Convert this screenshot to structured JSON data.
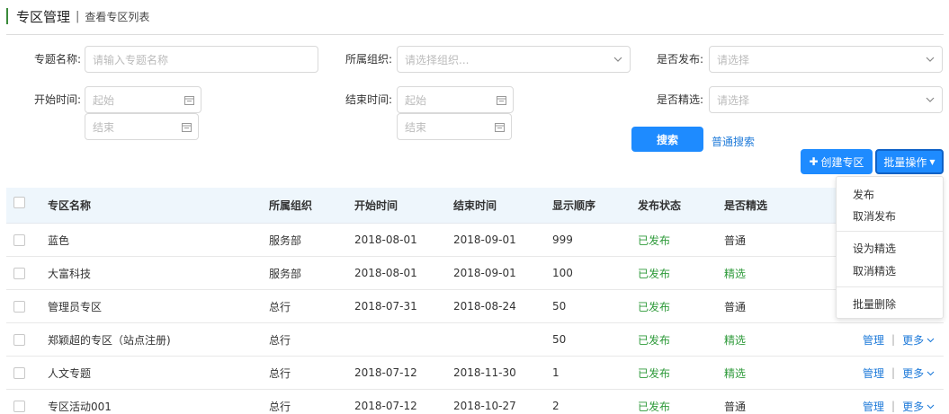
{
  "header": {
    "title": "专区管理",
    "separator": "|",
    "subtitle": "查看专区列表"
  },
  "filters": {
    "topic_name": {
      "label": "专题名称:",
      "placeholder": "请输入专题名称"
    },
    "org": {
      "label": "所属组织:",
      "placeholder": "请选择组织..."
    },
    "published": {
      "label": "是否发布:",
      "placeholder": "请选择"
    },
    "start_time": {
      "label": "开始时间:",
      "from_placeholder": "起始",
      "to_placeholder": "结束"
    },
    "end_time": {
      "label": "结束时间:",
      "from_placeholder": "起始",
      "to_placeholder": "结束"
    },
    "featured": {
      "label": "是否精选:",
      "placeholder": "请选择"
    },
    "search_button": "搜索",
    "normal_search_link": "普通搜索"
  },
  "toolbar": {
    "create_button": "创建专区",
    "batch_button": "批量操作"
  },
  "table": {
    "columns": [
      "专区名称",
      "所属组织",
      "开始时间",
      "结束时间",
      "显示顺序",
      "发布状态",
      "是否精选"
    ],
    "rows": [
      {
        "name": "蓝色",
        "org": "服务部",
        "start": "2018-08-01",
        "end": "2018-09-01",
        "order": "999",
        "status": "已发布",
        "featured": "普通"
      },
      {
        "name": "大富科技",
        "org": "服务部",
        "start": "2018-08-01",
        "end": "2018-09-01",
        "order": "100",
        "status": "已发布",
        "featured": "精选"
      },
      {
        "name": "管理员专区",
        "org": "总行",
        "start": "2018-07-31",
        "end": "2018-08-24",
        "order": "50",
        "status": "已发布",
        "featured": "普通"
      },
      {
        "name": "郑颖超的专区（站点注册)",
        "org": "总行",
        "start": "",
        "end": "",
        "order": "50",
        "status": "已发布",
        "featured": "精选",
        "manage": "管理",
        "more": "更多"
      },
      {
        "name": "人文专题",
        "org": "总行",
        "start": "2018-07-12",
        "end": "2018-11-30",
        "order": "1",
        "status": "已发布",
        "featured": "精选",
        "manage": "管理",
        "more": "更多"
      },
      {
        "name": "专区活动001",
        "org": "总行",
        "start": "2018-07-12",
        "end": "2018-10-27",
        "order": "2",
        "status": "已发布",
        "featured": "普通",
        "manage": "管理",
        "more": "更多"
      }
    ]
  },
  "batch_menu": {
    "items": [
      "发布",
      "取消发布",
      "设为精选",
      "取消精选",
      "批量删除"
    ]
  },
  "colors": {
    "primary": "#1e8bff",
    "link": "#1e7ad9",
    "success": "#2e9a3a",
    "header_accent": "#3a8a3a",
    "table_header_bg": "#eef6fc"
  },
  "icons": [
    "chevron-down-icon",
    "calendar-icon",
    "plus-icon",
    "caret-down-icon",
    "checkbox"
  ]
}
